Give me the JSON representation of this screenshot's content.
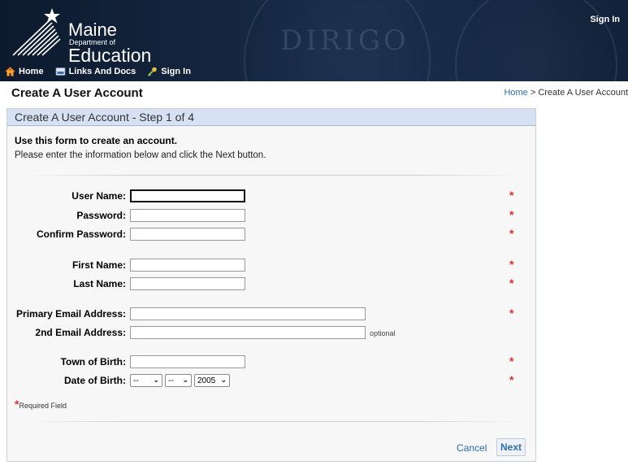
{
  "header": {
    "logo_line1": "Maine",
    "logo_line2": "Department of",
    "logo_line3": "Education",
    "top_signin": "Sign In",
    "seal_text": "DIRIGO",
    "nav": [
      {
        "label": "Home",
        "icon": "home-icon"
      },
      {
        "label": "Links And Docs",
        "icon": "document-icon"
      },
      {
        "label": "Sign In",
        "icon": "key-icon"
      }
    ]
  },
  "page": {
    "title": "Create A User Account",
    "breadcrumb_home": "Home",
    "breadcrumb_sep": " > ",
    "breadcrumb_current": "Create A User Account"
  },
  "panel": {
    "header": "Create A User Account - Step 1 of 4",
    "intro_bold": "Use this form to create an account.",
    "intro_text": "Please enter the information below and click the Next button."
  },
  "form": {
    "user_name_label": "User Name:",
    "password_label": "Password:",
    "confirm_password_label": "Confirm Password:",
    "first_name_label": "First Name:",
    "last_name_label": "Last Name:",
    "primary_email_label": "Primary Email Address:",
    "second_email_label": "2nd Email Address:",
    "optional_text": "optional",
    "town_label": "Town of Birth:",
    "dob_label": "Date of Birth:",
    "dob_month": "--",
    "dob_day": "--",
    "dob_year": "2005",
    "required_marker": "*",
    "required_note": "Required Field"
  },
  "actions": {
    "cancel": "Cancel",
    "next": "Next"
  },
  "colors": {
    "header_bg": "#14263f",
    "panel_header_bg": "#d6e2f4",
    "link": "#2a6fb0",
    "required": "#e03030"
  }
}
